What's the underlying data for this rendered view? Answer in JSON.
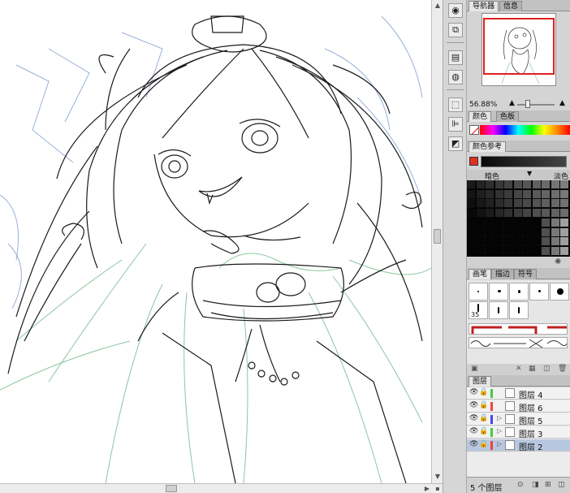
{
  "navigator": {
    "tabs": [
      {
        "label": "导航器"
      },
      {
        "label": "信息"
      }
    ],
    "zoom": "56.88%"
  },
  "color_panel": {
    "tabs": [
      {
        "label": "颜色"
      },
      {
        "label": "色板"
      }
    ],
    "current_color": "#e03020"
  },
  "color_reference": {
    "tab": "颜色参考",
    "dark_label": "暗色",
    "light_label": "淡色"
  },
  "brushes": {
    "tabs": [
      {
        "label": "画笔"
      },
      {
        "label": "描边"
      },
      {
        "label": "符号"
      }
    ],
    "size_label": "35"
  },
  "layers": {
    "tab": "图层",
    "items": [
      {
        "name": "图层 4",
        "color": "#44cc44",
        "selected": false
      },
      {
        "name": "图层 6",
        "color": "#ee4444",
        "selected": false
      },
      {
        "name": "图层 5",
        "color": "#4444ee",
        "selected": false
      },
      {
        "name": "图层 3",
        "color": "#44cc44",
        "selected": false
      },
      {
        "name": "图层 2",
        "color": "#ee4444",
        "selected": true
      }
    ],
    "count": "5 个图层"
  },
  "icons": {
    "scroll_up": "up-arrow-icon",
    "scroll_down": "down-arrow-icon",
    "scroll_left": "left-arrow-icon",
    "scroll_right": "right-arrow-icon"
  }
}
